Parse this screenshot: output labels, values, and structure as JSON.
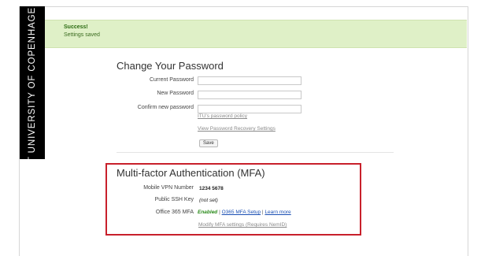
{
  "sidebar": {
    "institution": "IT UNIVERSITY OF COPENHAGEN"
  },
  "alert": {
    "title": "Success!",
    "message": "Settings saved"
  },
  "password_section": {
    "heading": "Change Your Password",
    "current_label": "Current Password",
    "new_label": "New Password",
    "confirm_label": "Confirm new password",
    "policy_link": "ITU's password policy",
    "recovery_link": "View Password Recovery Settings",
    "save_label": "Save"
  },
  "mfa_section": {
    "heading": "Multi-factor Authentication (MFA)",
    "vpn_label": "Mobile VPN Number",
    "vpn_value": "1234 5678",
    "ssh_label": "Public SSH Key",
    "ssh_value": "(not set)",
    "o365_label": "Office 365 MFA",
    "o365_status": "Enabled",
    "o365_separator": " | ",
    "o365_setup_link": "O365 MFA Setup",
    "o365_learn_link": "Learn more",
    "modify_link": "Modify MFA settings (Requires NemID)"
  },
  "colors": {
    "highlight_border": "#c8202b",
    "success_background": "#dff0c7",
    "enabled_green": "#2a8a1a",
    "link_blue": "#1a4fb3"
  }
}
